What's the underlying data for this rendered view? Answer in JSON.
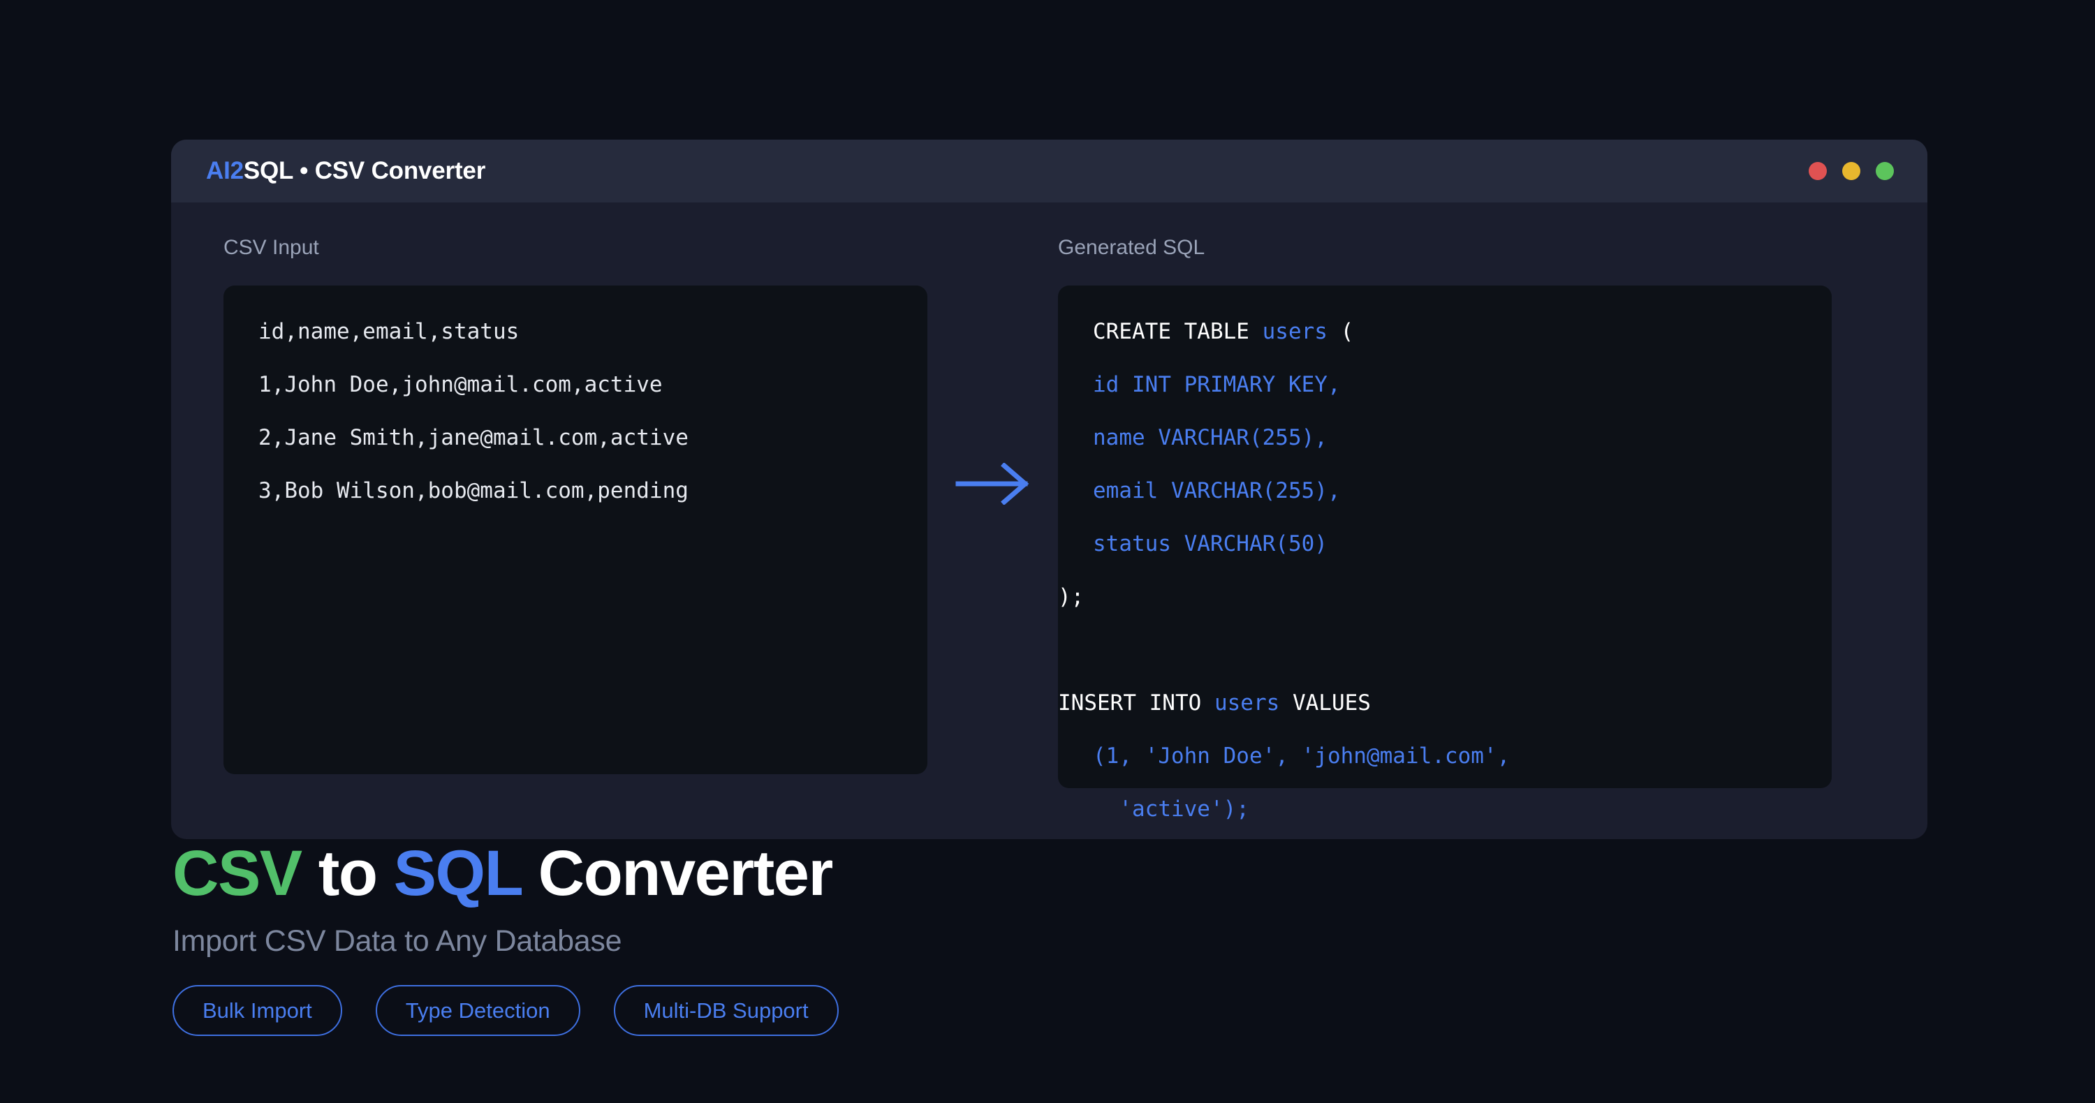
{
  "window": {
    "title_accent": "AI2",
    "title_rest": "SQL • CSV Converter",
    "controls": {
      "close_label": "close",
      "minimize_label": "minimize",
      "maximize_label": "maximize",
      "close_color": "#e05252",
      "minimize_color": "#e8b72e",
      "maximize_color": "#5cc45c"
    }
  },
  "panes": {
    "input": {
      "label": "CSV Input",
      "lines": [
        "id,name,email,status",
        "1,John Doe,john@mail.com,active",
        "2,Jane Smith,jane@mail.com,active",
        "3,Bob Wilson,bob@mail.com,pending"
      ]
    },
    "arrow": {
      "icon": "arrow-right-icon",
      "color": "#4a7ef0"
    },
    "output": {
      "label": "Generated SQL",
      "lines": [
        {
          "indent": true,
          "parts": [
            {
              "t": "CREATE TABLE ",
              "c": "key"
            },
            {
              "t": "users",
              "c": "id"
            },
            {
              "t": " (",
              "c": "key"
            }
          ]
        },
        {
          "indent": true,
          "parts": [
            {
              "t": "id INT PRIMARY KEY,",
              "c": "blue"
            }
          ]
        },
        {
          "indent": true,
          "parts": [
            {
              "t": "name VARCHAR(255),",
              "c": "blue"
            }
          ]
        },
        {
          "indent": true,
          "parts": [
            {
              "t": "email VARCHAR(255),",
              "c": "blue"
            }
          ]
        },
        {
          "indent": true,
          "parts": [
            {
              "t": "status VARCHAR(50)",
              "c": "blue"
            }
          ]
        },
        {
          "indent": false,
          "parts": [
            {
              "t": ");",
              "c": "key"
            }
          ]
        },
        {
          "indent": false,
          "parts": [
            {
              "t": "",
              "c": "key"
            }
          ]
        },
        {
          "indent": false,
          "parts": [
            {
              "t": "INSERT INTO ",
              "c": "key"
            },
            {
              "t": "users",
              "c": "id"
            },
            {
              "t": " VALUES",
              "c": "key"
            }
          ]
        },
        {
          "indent": true,
          "parts": [
            {
              "t": "(1, 'John Doe', 'john@mail.com',",
              "c": "blue"
            }
          ]
        },
        {
          "indent": true,
          "parts": [
            {
              "t": "  'active');",
              "c": "blue"
            }
          ]
        }
      ]
    }
  },
  "hero": {
    "title_part1": "CSV",
    "title_part2": " to ",
    "title_part3": "SQL",
    "title_part4": " Converter",
    "subtitle": "Import CSV Data to Any Database",
    "pills": [
      {
        "label": "Bulk Import"
      },
      {
        "label": "Type Detection"
      },
      {
        "label": "Multi-DB Support"
      }
    ],
    "colors": {
      "green": "#52c06a",
      "blue": "#4a7ef0",
      "white": "#ffffff",
      "subtitle": "#7d879e"
    }
  }
}
